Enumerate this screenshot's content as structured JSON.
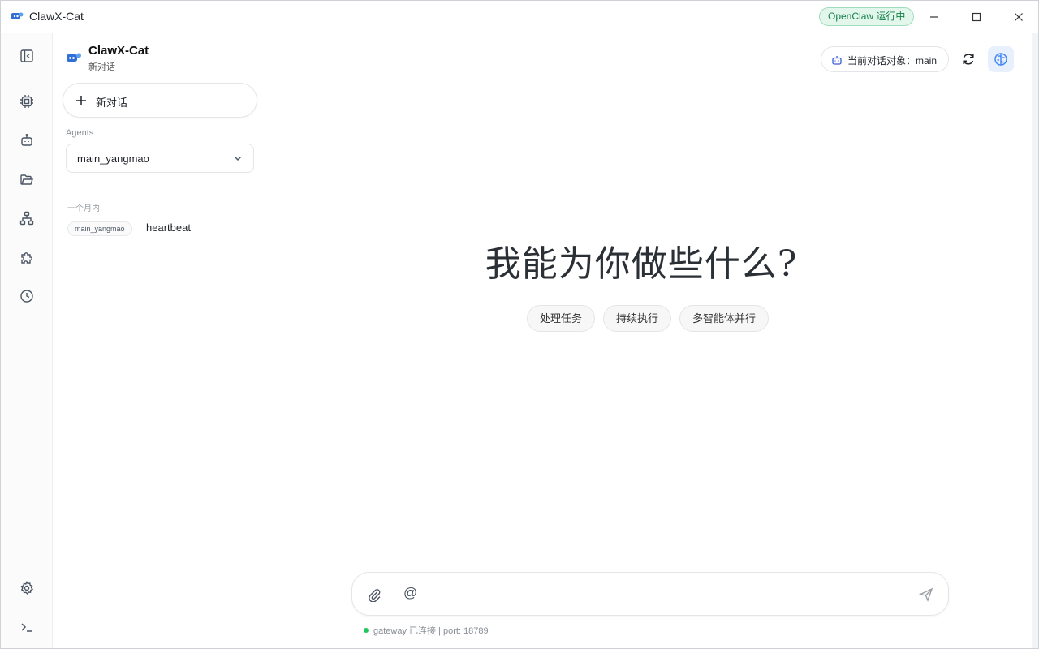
{
  "window": {
    "title": "ClawX-Cat"
  },
  "status": {
    "label": "OpenClaw 运行中",
    "color": "#16804a"
  },
  "rail": {
    "items": [
      {
        "name": "collapse-sidebar-icon"
      },
      {
        "name": "cpu-icon"
      },
      {
        "name": "robot-icon"
      },
      {
        "name": "folder-icon"
      },
      {
        "name": "network-icon"
      },
      {
        "name": "puzzle-icon"
      },
      {
        "name": "clock-icon"
      },
      {
        "name": "gear-icon"
      },
      {
        "name": "terminal-icon"
      }
    ]
  },
  "sidebar": {
    "brand": {
      "name": "ClawX-Cat",
      "subtitle": "新对话"
    },
    "new_chat_label": "新对话",
    "agents_label": "Agents",
    "agent_selected": "main_yangmao",
    "group_label": "一个月内",
    "conversations": [
      {
        "agent": "main_yangmao",
        "title": "heartbeat"
      }
    ]
  },
  "main": {
    "target_label": "当前对话对象：main",
    "hero_text": "我能为你做些什么?",
    "chips": [
      "处理任务",
      "持续执行",
      "多智能体并行"
    ],
    "composer": {
      "at_symbol": "@",
      "placeholder": ""
    },
    "gateway_status": "gateway 已连接 | port: 18789"
  },
  "colors": {
    "accent": "#3b82f6",
    "status_bg": "#e3f6ec",
    "online_dot": "#22c55e"
  }
}
